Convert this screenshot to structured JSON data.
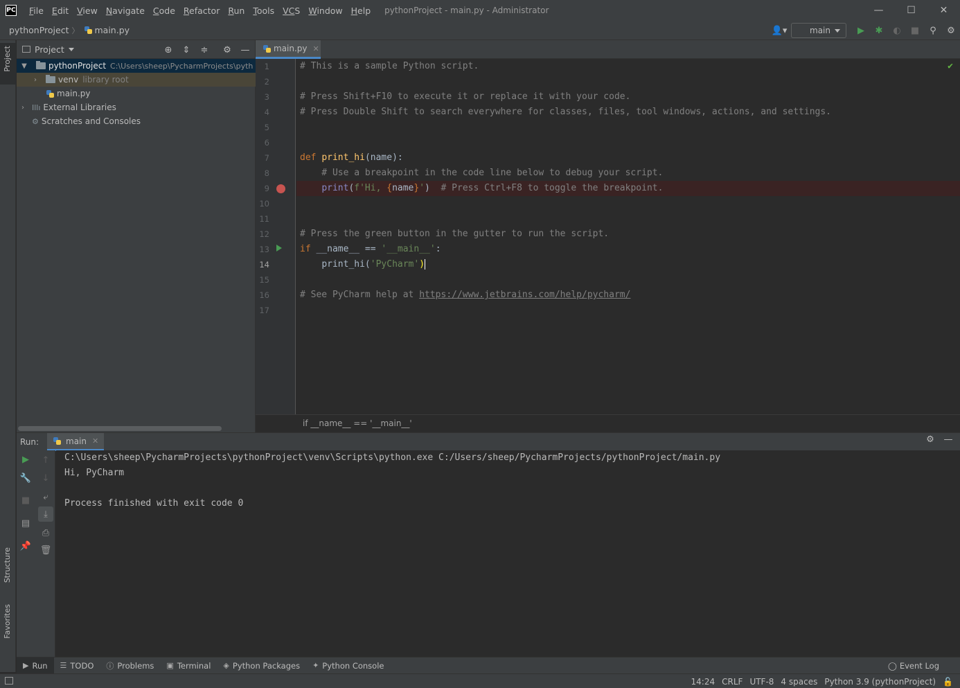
{
  "window": {
    "logo": "PC",
    "title": "pythonProject - main.py - Administrator",
    "menu": [
      {
        "first": "F",
        "rest": "ile"
      },
      {
        "first": "E",
        "rest": "dit"
      },
      {
        "first": "V",
        "rest": "iew"
      },
      {
        "first": "N",
        "rest": "avigate"
      },
      {
        "first": "C",
        "rest": "ode"
      },
      {
        "first": "R",
        "rest": "efactor"
      },
      {
        "first": "R",
        "rest": "un"
      },
      {
        "first": "T",
        "rest": "ools"
      },
      {
        "first": "VC",
        "rest": "S"
      },
      {
        "first": "W",
        "rest": "indow"
      },
      {
        "first": "H",
        "rest": "elp"
      }
    ]
  },
  "navbar": {
    "project": "pythonProject",
    "file": "main.py",
    "run_config": "main"
  },
  "sidebar_tabs": {
    "project": "Project",
    "structure": "Structure",
    "favorites": "Favorites"
  },
  "project_panel": {
    "title": "Project",
    "tree": {
      "root_name": "pythonProject",
      "root_path": "C:\\Users\\sheep\\PycharmProjects\\pyth",
      "venv_name": "venv",
      "venv_hint": "library root",
      "main_file": "main.py",
      "external": "External Libraries",
      "scratches": "Scratches and Consoles"
    }
  },
  "editor": {
    "tab": "main.py",
    "line_numbers": [
      "1",
      "2",
      "3",
      "4",
      "5",
      "6",
      "7",
      "8",
      "9",
      "10",
      "11",
      "12",
      "13",
      "14",
      "15",
      "16",
      "17"
    ],
    "current_line": "14",
    "code": {
      "l1": "# This is a sample Python script.",
      "l3": "# Press Shift+F10 to execute it or replace it with your code.",
      "l4": "# Press Double Shift to search everywhere for classes, files, tool windows, actions, and settings.",
      "l7_kw": "def ",
      "l7_fn": "print_hi",
      "l7_rest": "(name):",
      "l8": "    # Use a breakpoint in the code line below to debug your script.",
      "l9_indent": "    ",
      "l9_builtin": "print",
      "l9_open": "(",
      "l9_str1": "f'Hi, ",
      "l9_brace1": "{",
      "l9_param": "name",
      "l9_brace2": "}",
      "l9_str2": "'",
      "l9_close": ")",
      "l9_comment": "  # Press Ctrl+F8 to toggle the breakpoint.",
      "l12": "# Press the green button in the gutter to run the script.",
      "l13_kw": "if ",
      "l13_rest": "__name__ == ",
      "l13_str": "'__main__'",
      "l13_colon": ":",
      "l14_indent": "    ",
      "l14_fn": "print_hi(",
      "l14_str": "'PyCharm'",
      "l14_close": ")",
      "l16_comment": "# See PyCharm help at ",
      "l16_link": "https://www.jetbrains.com/help/pycharm/"
    },
    "breadcrumb": "if __name__ == '__main__'"
  },
  "run_panel": {
    "label": "Run:",
    "tab": "main",
    "console": [
      "C:\\Users\\sheep\\PycharmProjects\\pythonProject\\venv\\Scripts\\python.exe C:/Users/sheep/PycharmProjects/pythonProject/main.py",
      "Hi, PyCharm",
      "",
      "Process finished with exit code 0"
    ]
  },
  "bottom_tabs": {
    "run": "Run",
    "todo": "TODO",
    "problems": "Problems",
    "terminal": "Terminal",
    "packages": "Python Packages",
    "console": "Python Console",
    "event_log": "Event Log"
  },
  "status": {
    "position": "14:24",
    "line_sep": "CRLF",
    "encoding": "UTF-8",
    "indent": "4 spaces",
    "interpreter": "Python 3.9 (pythonProject)"
  },
  "colors": {
    "accent": "#4a88c7",
    "run_green": "#499c54",
    "breakpoint": "#c75450"
  }
}
